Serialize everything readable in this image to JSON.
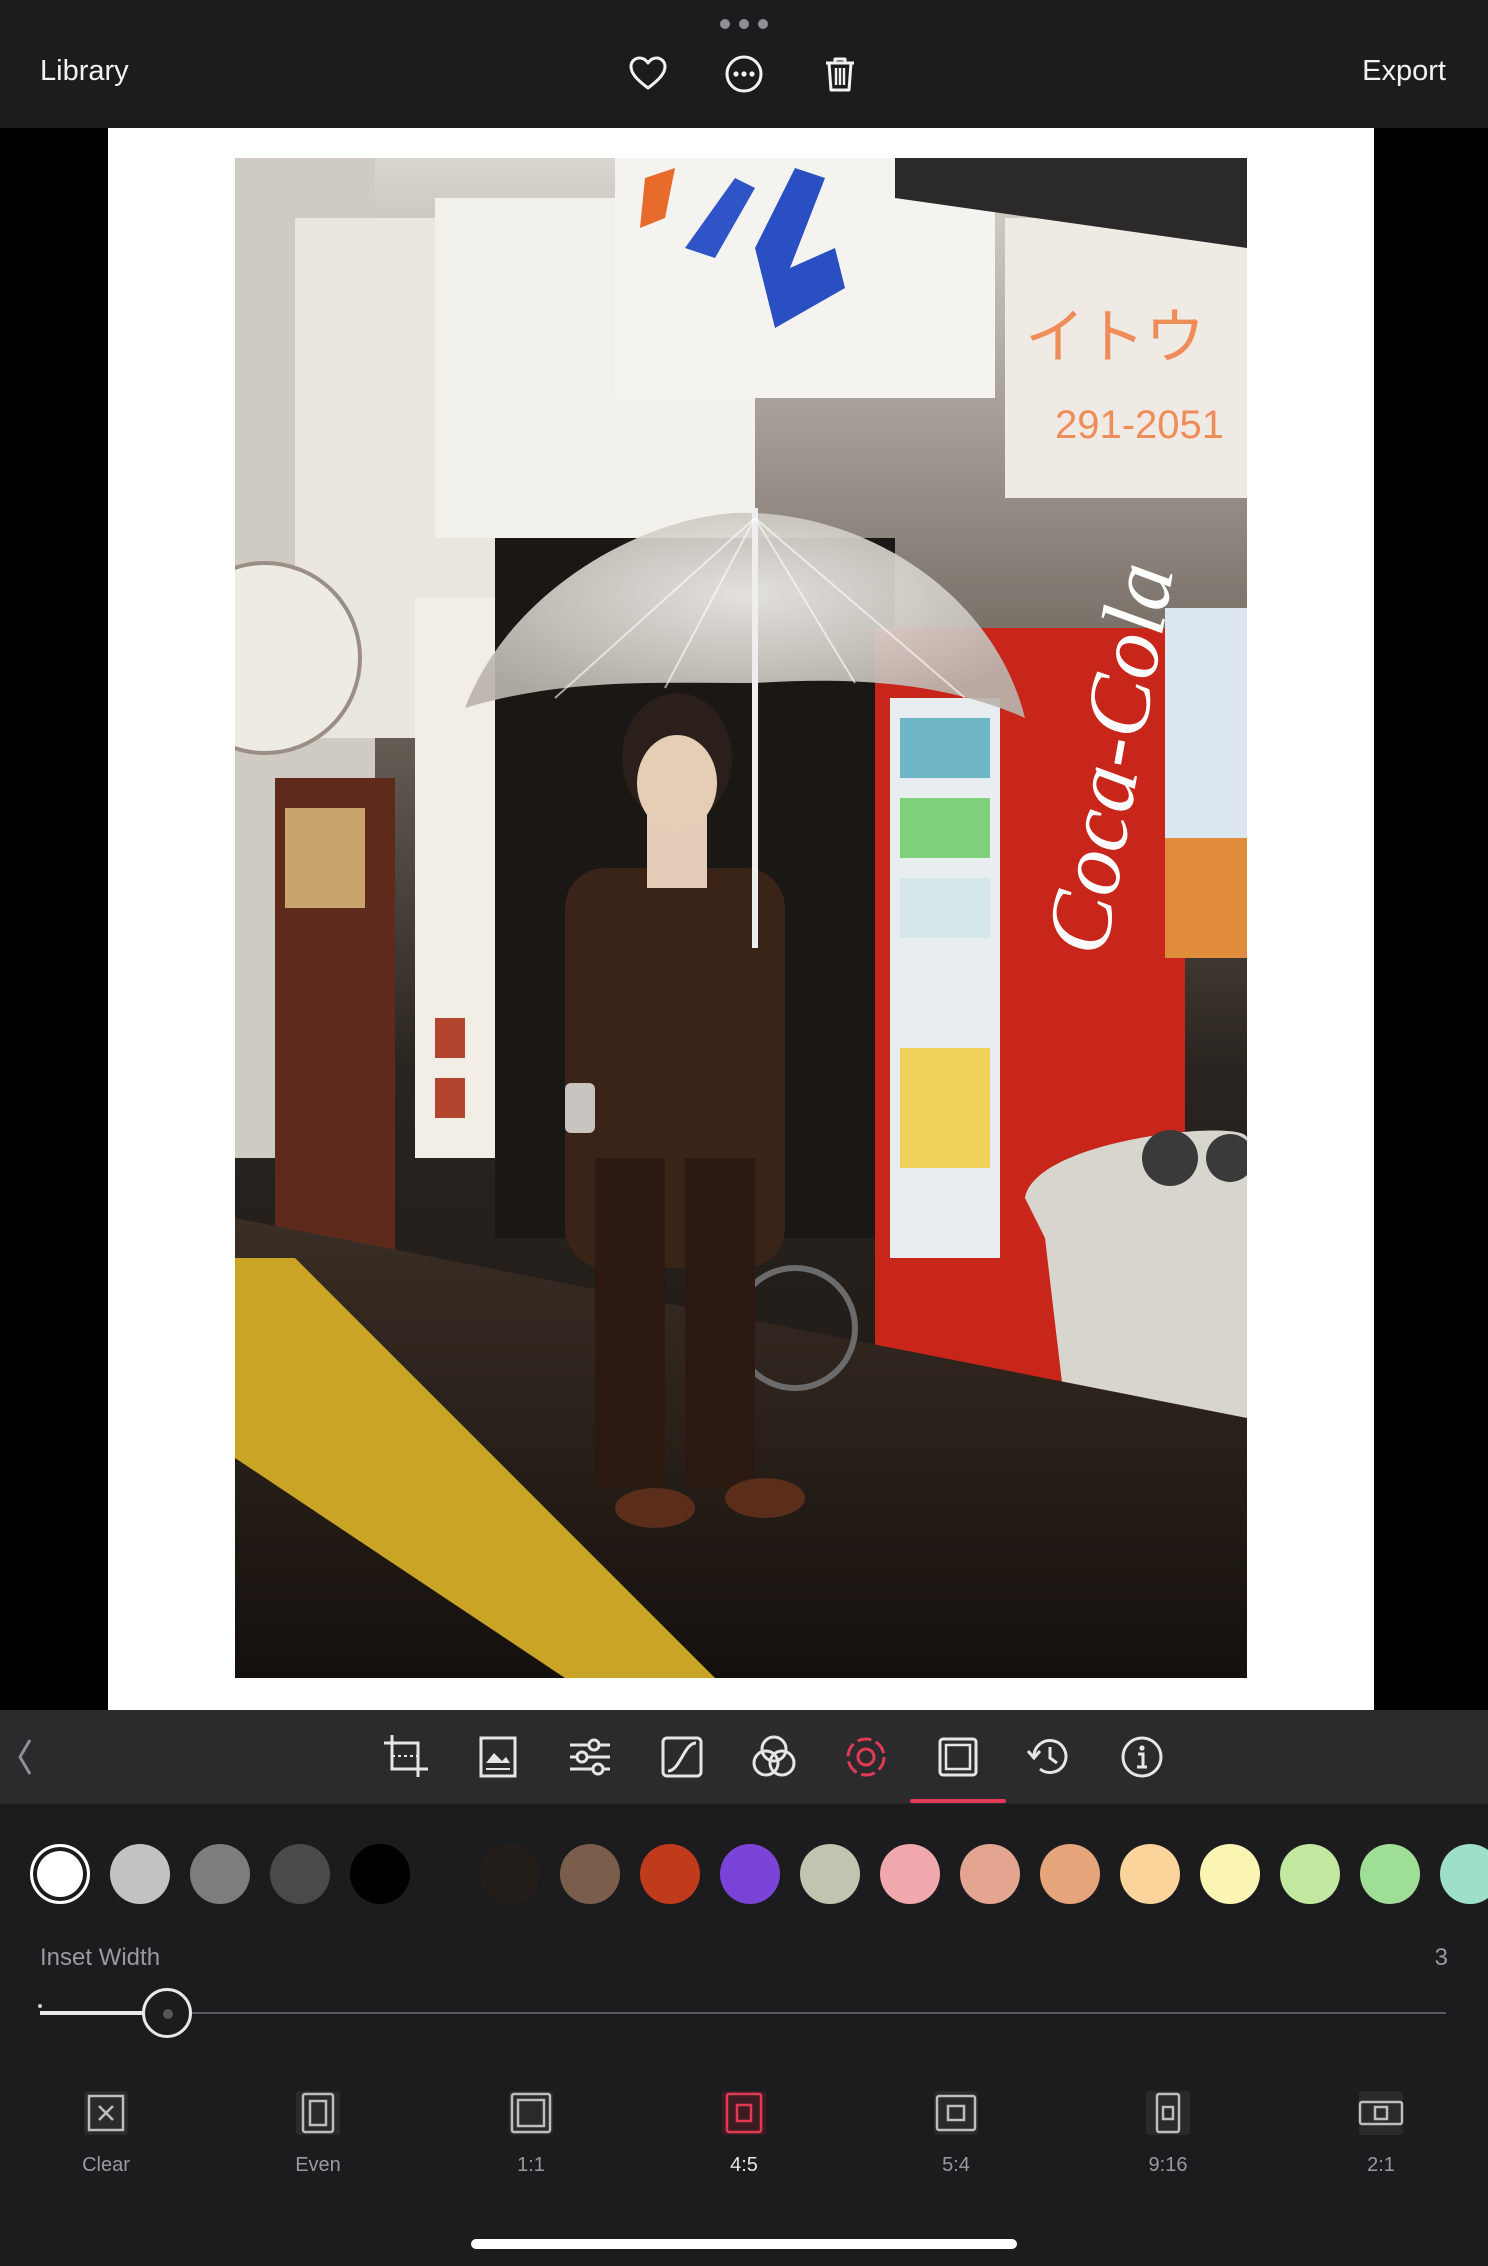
{
  "topbar": {
    "library_label": "Library",
    "export_label": "Export",
    "icons": [
      "heart-icon",
      "more-options-icon",
      "trash-icon"
    ]
  },
  "photo": {
    "description_icon": "street-photo"
  },
  "toolbar": {
    "active_tool": "frame",
    "accent_color": "#e23a55",
    "tools": [
      "crop",
      "image",
      "adjust",
      "curves",
      "color-mix",
      "selective-color",
      "frame",
      "history",
      "info"
    ]
  },
  "frame": {
    "colors": [
      "#ffffff",
      "#c2c2c2",
      "#7d7d7d",
      "#4a4a4a",
      "#000000",
      "#231d1a",
      "#7a5e4b",
      "#c03b1c",
      "#7b44d8",
      "#c1c4b0",
      "#f0a7ad",
      "#e4a590",
      "#e6a47a",
      "#fbd49c",
      "#fbf5b4",
      "#c2e8a0",
      "#9ede96",
      "#9edfcb"
    ],
    "selected_color": "#ffffff",
    "inset_label": "Inset Width",
    "inset_value": "3",
    "inset_fraction": 0.09
  },
  "ratios": [
    {
      "label": "Clear",
      "active": false
    },
    {
      "label": "Even",
      "active": false
    },
    {
      "label": "1:1",
      "active": false
    },
    {
      "label": "4:5",
      "active": true
    },
    {
      "label": "5:4",
      "active": false
    },
    {
      "label": "9:16",
      "active": false
    },
    {
      "label": "2:1",
      "active": false
    }
  ]
}
